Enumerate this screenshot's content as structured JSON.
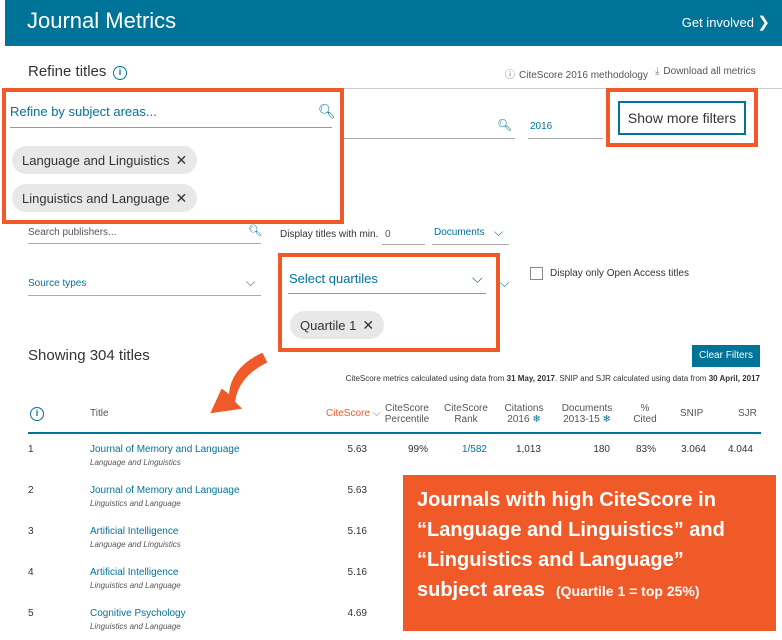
{
  "header": {
    "title": "Journal Metrics",
    "get_involved": "Get involved"
  },
  "refine": {
    "title": "Refine titles",
    "methodology_link": "CiteScore 2016 methodology",
    "download_link": "Download all metrics",
    "subject_placeholder": "Refine by subject areas...",
    "subject_chips": [
      "Language and Linguistics",
      "Linguistics and Language"
    ],
    "year": "2016",
    "show_more_filters": "Show more filters",
    "publishers_placeholder": "Search publishers...",
    "display_min_label": "Display titles with min.",
    "display_min_value": "0",
    "documents_select": "Documents",
    "source_types": "Source types",
    "quartiles_placeholder": "Select quartiles",
    "quartile_chip": "Quartile 1",
    "open_access_label": "Display only Open Access titles"
  },
  "results": {
    "showing": "Showing 304 titles",
    "clear_filters": "Clear Filters",
    "note_prefix": "CiteScore metrics calculated using data from ",
    "note_date1": "31 May, 2017",
    "note_mid": ". SNIP and SJR calculated using data from ",
    "note_date2": "30 April, 2017"
  },
  "table": {
    "headers": {
      "title": "Title",
      "citescore": "CiteScore",
      "percentile_1": "CiteScore",
      "percentile_2": "Percentile",
      "rank_1": "CiteScore",
      "rank_2": "Rank",
      "citations_1": "Citations",
      "citations_2": "2016",
      "documents_1": "Documents",
      "documents_2": "2013-15",
      "cited_1": "%",
      "cited_2": "Cited",
      "snip": "SNIP",
      "sjr": "SJR"
    },
    "rows": [
      {
        "num": "1",
        "title": "Journal of Memory and Language",
        "subject": "Language and Linguistics",
        "citescore": "5.63",
        "percentile": "99%",
        "rank": "1/582",
        "citations": "1,013",
        "documents": "180",
        "cited": "83%",
        "snip": "3.064",
        "sjr": "4.044"
      },
      {
        "num": "2",
        "title": "Journal of Memory and Language",
        "subject": "Linguistics and Language",
        "citescore": "5.63"
      },
      {
        "num": "3",
        "title": "Artificial Intelligence",
        "subject": "Language and Linguistics",
        "citescore": "5.16"
      },
      {
        "num": "4",
        "title": "Artificial Intelligence",
        "subject": "Linguistics and Language",
        "citescore": "5.16"
      },
      {
        "num": "5",
        "title": "Cognitive Psychology",
        "subject": "Linguistics and Language",
        "citescore": "4.69"
      }
    ]
  },
  "callout": {
    "line1": "Journals with high CiteScore in",
    "line2": "“Language and Linguistics” and",
    "line3": "“Linguistics and Language”",
    "line4": "subject areas",
    "note": "(Quartile 1 = top 25%)"
  },
  "colors": {
    "brand": "#007398",
    "accent": "#f05a28"
  }
}
